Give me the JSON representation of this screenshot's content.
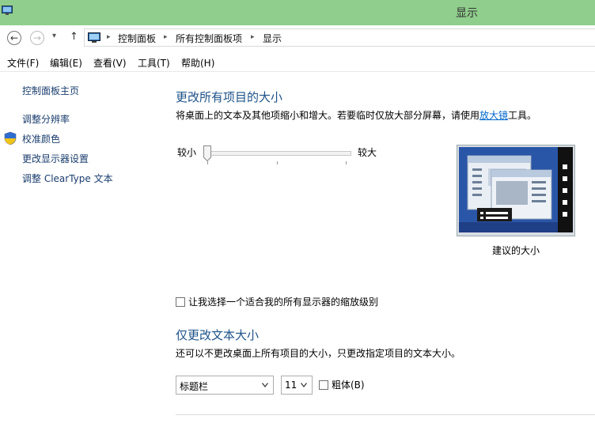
{
  "window": {
    "title": "显示"
  },
  "nav": {
    "back": "←",
    "forward": "→",
    "dropdown": "▾",
    "up": "↑",
    "breadcrumb": [
      "控制面板",
      "所有控制面板项",
      "显示"
    ],
    "sep": "▸"
  },
  "menu": [
    "文件(F)",
    "编辑(E)",
    "查看(V)",
    "工具(T)",
    "帮助(H)"
  ],
  "sidebar": {
    "home": "控制面板主页",
    "items": [
      "调整分辨率",
      "校准颜色",
      "更改显示器设置",
      "调整 ClearType 文本"
    ]
  },
  "size_section": {
    "heading": "更改所有项目的大小",
    "desc_prefix": "将桌面上的文本及其他项缩小和增大。若要临时仅放大部分屏幕，请使用",
    "desc_link": "放大镜",
    "desc_suffix": "工具。",
    "slider_min": "较小",
    "slider_max": "较大",
    "slider_level": 0,
    "preview_caption": "建议的大小",
    "checkbox_label": "让我选择一个适合我的所有显示器的缩放级别",
    "checkbox_checked": false
  },
  "text_section": {
    "heading": "仅更改文本大小",
    "desc": "还可以不更改桌面上所有项目的大小，只更改指定项目的文本大小。",
    "item_select": "标题栏",
    "size_select": "11",
    "bold_label": "粗体(B)",
    "bold_checked": false
  },
  "colors": {
    "titlebar": "#8fce8c",
    "heading": "#1d5288",
    "link": "#1a3d6d"
  }
}
